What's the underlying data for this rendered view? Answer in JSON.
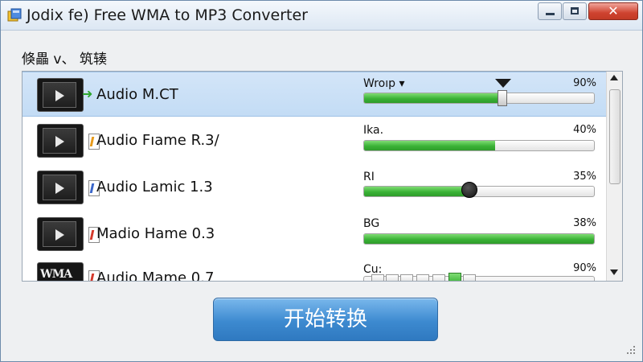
{
  "window": {
    "title": "Jodix fe) Free WMA to MP3 Converter"
  },
  "titlebar_buttons": {
    "minimize": "—",
    "maximize": "□",
    "close": "✕"
  },
  "menu": {
    "item": "倏畾 v、 筑辏"
  },
  "files": [
    {
      "name": "Audio M.CT",
      "label": "Wroıp ▾",
      "percent_text": "90%",
      "progress": 60,
      "selected": true,
      "icon": "play-thumbnail",
      "status_icon": "green-arrow-icon"
    },
    {
      "name": "Audio Fıame R.3/",
      "label": "Ika.",
      "percent_text": "40%",
      "progress": 57,
      "selected": false,
      "icon": "play-thumbnail",
      "status_icon": "orange-file-icon"
    },
    {
      "name": "Audio Lamic 1.3",
      "label": "RI",
      "percent_text": "35%",
      "progress": 46,
      "selected": false,
      "icon": "play-thumbnail",
      "status_icon": "blue-file-icon"
    },
    {
      "name": "Madio Hame 0.3",
      "label": "BG",
      "percent_text": "38%",
      "progress": 100,
      "selected": false,
      "icon": "play-thumbnail",
      "status_icon": "red-file-icon"
    },
    {
      "name": "Audio Mame 0.7",
      "label": "Cu:",
      "percent_text": "90%",
      "progress": 0,
      "selected": false,
      "icon": "wma-thumbnail",
      "status_icon": "red-file-icon"
    }
  ],
  "wma_thumb_text": "WMA",
  "start_button": {
    "label": "开始转换"
  },
  "colors": {
    "accent": "#3d8ad0",
    "progress_green": "#3ab236",
    "selected_row": "#c9dff6"
  }
}
